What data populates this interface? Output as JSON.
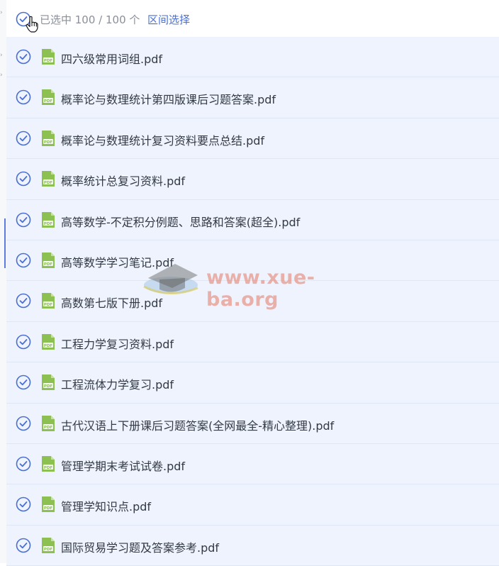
{
  "header": {
    "count_text": "已选中 100 / 100 个",
    "range_select_label": "区间选择"
  },
  "colors": {
    "accent": "#4a6fd1",
    "row_bg": "#eef3fd",
    "pdf_icon": "#8cc152"
  },
  "files": [
    {
      "name": "四六级常用词组.pdf",
      "icon": "pdf-file-icon"
    },
    {
      "name": "概率论与数理统计第四版课后习题答案.pdf",
      "icon": "pdf-file-icon"
    },
    {
      "name": "概率论与数理统计复习资料要点总结.pdf",
      "icon": "pdf-file-icon"
    },
    {
      "name": "概率统计总复习资料.pdf",
      "icon": "pdf-file-icon"
    },
    {
      "name": "高等数学-不定积分例题、思路和答案(超全).pdf",
      "icon": "pdf-file-icon"
    },
    {
      "name": "高等数学学习笔记.pdf",
      "icon": "pdf-file-icon"
    },
    {
      "name": "高数第七版下册.pdf",
      "icon": "pdf-file-icon"
    },
    {
      "name": "工程力学复习资料.pdf",
      "icon": "pdf-file-icon"
    },
    {
      "name": "工程流体力学复习.pdf",
      "icon": "pdf-file-icon"
    },
    {
      "name": "古代汉语上下册课后习题答案(全网最全-精心整理).pdf",
      "icon": "pdf-file-icon"
    },
    {
      "name": "管理学期末考试试卷.pdf",
      "icon": "pdf-file-icon"
    },
    {
      "name": "管理学知识点.pdf",
      "icon": "pdf-file-icon"
    },
    {
      "name": "国际贸易学习题及答案参考.pdf",
      "icon": "pdf-file-icon"
    }
  ],
  "watermark": {
    "text": "www.xue-ba.org"
  }
}
